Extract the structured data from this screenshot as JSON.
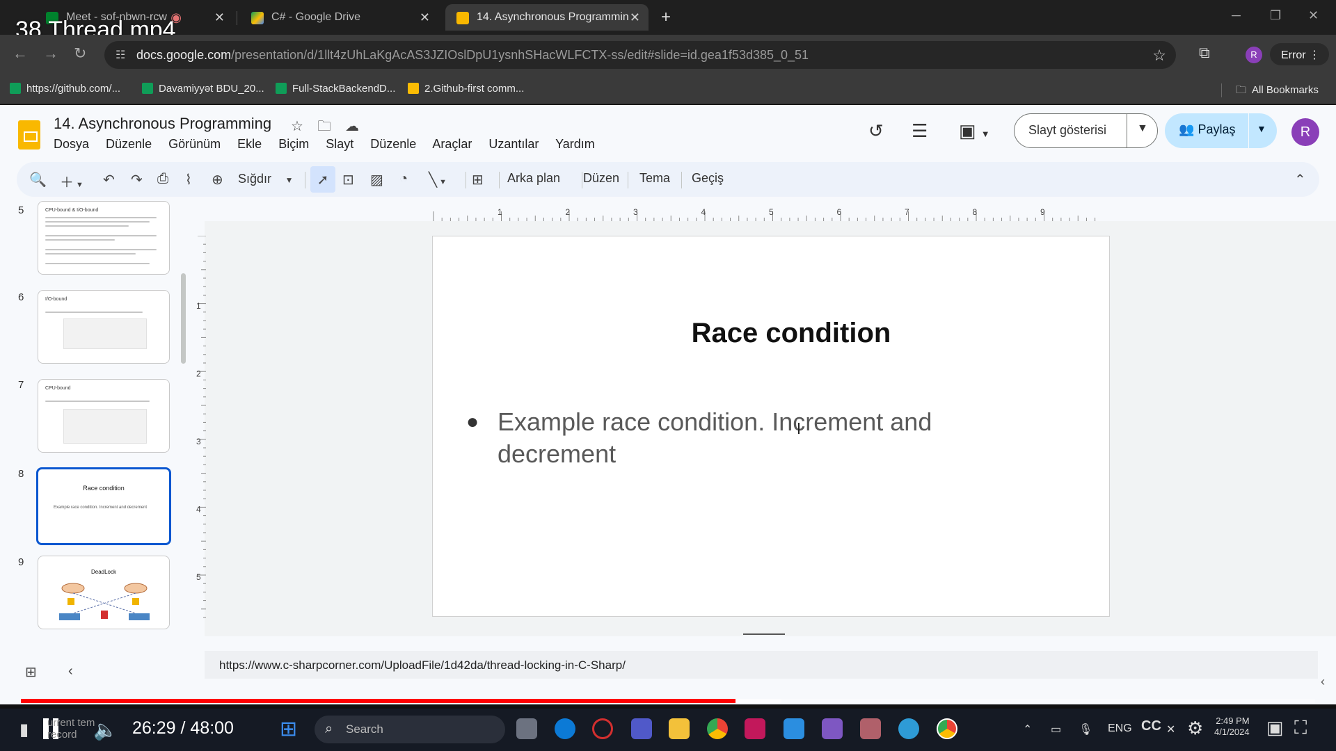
{
  "video": {
    "title": "38.Thread.mp4",
    "time_display": "26:29 / 48:00",
    "progress": 0.5519,
    "buffered": 0.5875
  },
  "browser": {
    "tabs": [
      {
        "label": "Meet - sof-nbwn-rcw",
        "recording": true,
        "active": false,
        "icon": "meet-icon"
      },
      {
        "label": "C# - Google Drive",
        "active": false,
        "icon": "drive-icon"
      },
      {
        "label": "14. Asynchronous Programmin",
        "active": true,
        "icon": "slides-icon"
      }
    ],
    "url_host": "docs.google.com",
    "url_path": "/presentation/d/1llt4zUhLaKgAcAS3JZIOslDpU1ysnhSHacWLFCTX-ss/edit#slide=id.gea1f53d385_0_51",
    "profile_initial": "R",
    "error_label": "Error",
    "bookmarks": [
      {
        "label": "https://github.com/...",
        "icon": "sheets-icon",
        "color": "#0f9d58"
      },
      {
        "label": "Davamiyyət BDU_20...",
        "icon": "sheets-icon",
        "color": "#0f9d58"
      },
      {
        "label": "Full-StackBackendD...",
        "icon": "sheets-icon",
        "color": "#0f9d58"
      },
      {
        "label": "2.Github-first comm...",
        "icon": "drive-icon",
        "color": "#fbbc04"
      }
    ],
    "all_bookmarks": "All Bookmarks"
  },
  "slides_app": {
    "doc_title": "14. Asynchronous Programming",
    "menu": [
      "Dosya",
      "Düzenle",
      "Görünüm",
      "Ekle",
      "Biçim",
      "Slayt",
      "Düzenle",
      "Araçlar",
      "Uzantılar",
      "Yardım"
    ],
    "slideshow_label": "Slayt gösterisi",
    "share_label": "Paylaş",
    "user_initial": "R",
    "toolbar": {
      "zoom_label": "Sığdır",
      "background": "Arka plan",
      "layout": "Düzen",
      "theme": "Tema",
      "transition": "Geçiş"
    },
    "ruler_h": [
      "1",
      "2",
      "3",
      "4",
      "5",
      "6",
      "7",
      "8",
      "9"
    ],
    "ruler_v": [
      "1",
      "2",
      "3",
      "4",
      "5"
    ],
    "filmstrip": [
      {
        "num": "5",
        "title": "CPU-bound & I/O-bound"
      },
      {
        "num": "6",
        "title": "I/O-bound"
      },
      {
        "num": "7",
        "title": "CPU-bound"
      },
      {
        "num": "8",
        "title": "Race condition",
        "body": "Example race condition. Increment and decrement",
        "selected": true
      },
      {
        "num": "9",
        "title": "DeadLock"
      }
    ],
    "slide": {
      "title": "Race condition",
      "bullet": "Example race condition. Increment and decrement"
    },
    "speaker_notes": "https://www.c-sharpcorner.com/UploadFile/1d42da/thread-locking-in-C-Sharp/"
  },
  "taskbar": {
    "search_placeholder": "Search",
    "lang": "ENG",
    "faded_text_1": "urrent tem",
    "faded_text_2": "record",
    "clock_time": "2:49 PM",
    "clock_date": "4/1/2024"
  },
  "colors": {
    "accent_blue": "#0b57d0",
    "share_bg": "#c2e7ff",
    "progress_red": "#ff0000",
    "slides_yellow": "#f9b800"
  }
}
